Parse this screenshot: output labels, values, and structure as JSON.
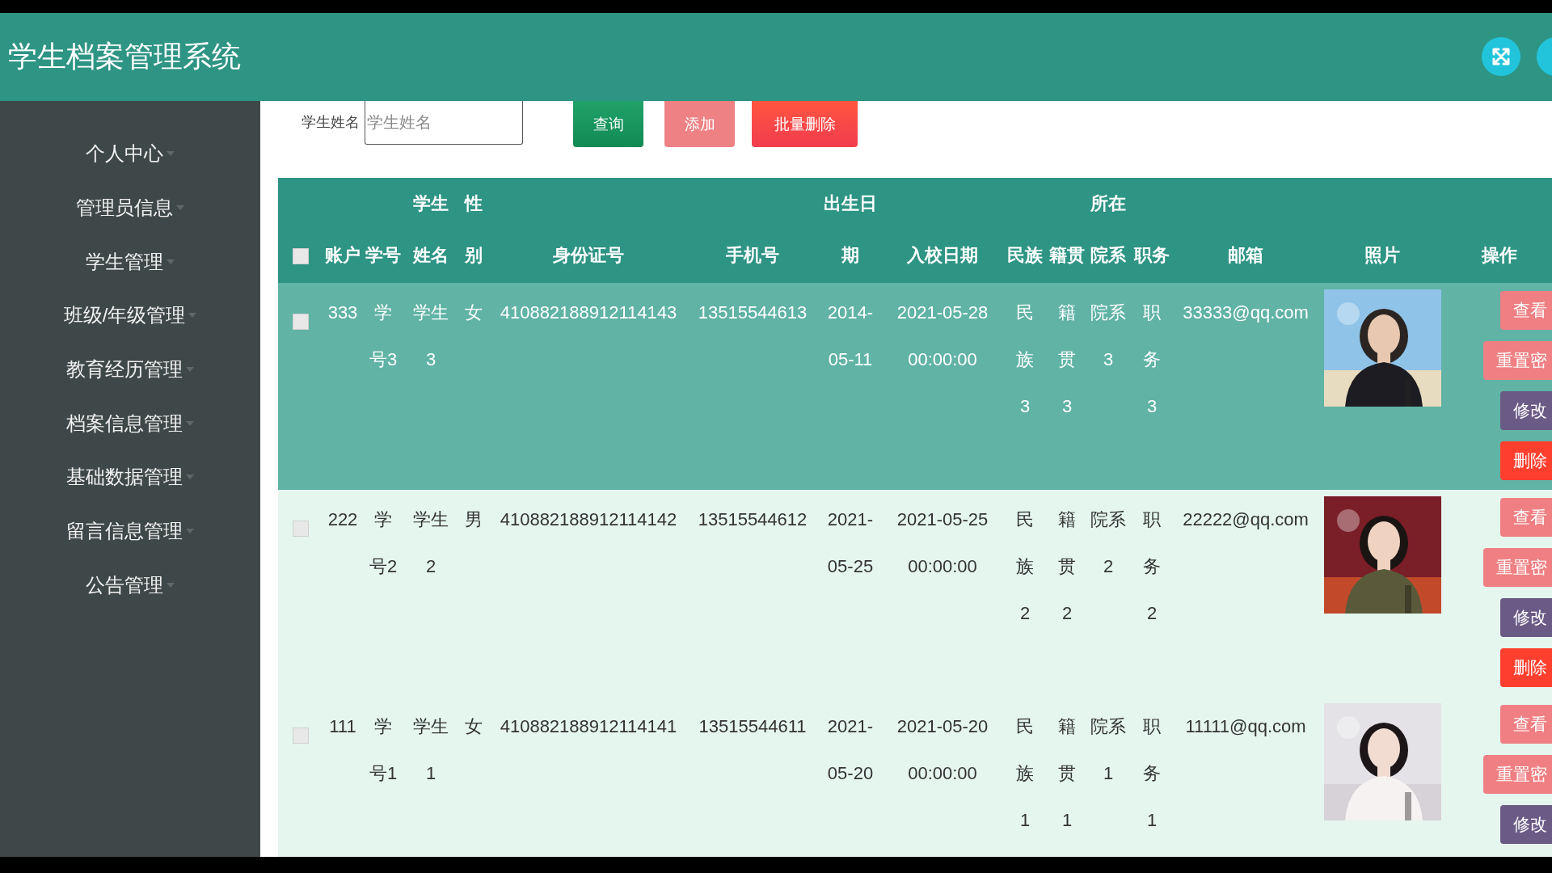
{
  "app": {
    "title": "学生档案管理系统"
  },
  "sidebar": {
    "items": [
      {
        "label": "个人中心"
      },
      {
        "label": "管理员信息"
      },
      {
        "label": "学生管理"
      },
      {
        "label": "班级/年级管理"
      },
      {
        "label": "教育经历管理"
      },
      {
        "label": "档案信息管理"
      },
      {
        "label": "基础数据管理"
      },
      {
        "label": "留言信息管理"
      },
      {
        "label": "公告管理"
      }
    ]
  },
  "search": {
    "label": "学生姓名",
    "placeholder": "学生姓名",
    "buttons": [
      {
        "label": "查询",
        "kind": "search"
      },
      {
        "label": "添加",
        "kind": "add"
      },
      {
        "label": "批量删除",
        "kind": "delete"
      }
    ]
  },
  "table": {
    "select_all": {
      "checked": false
    },
    "columns": [
      "账户",
      "学号",
      "学生姓名",
      "性别",
      "身份证号",
      "手机号",
      "出生日期",
      "入校日期",
      "民族",
      "籍贯",
      "所在院系",
      "职务",
      "邮箱",
      "照片",
      "操作"
    ],
    "rows": [
      {
        "selected": true,
        "checked": false,
        "cells": [
          "333",
          "学号3",
          "学生3",
          "女",
          "410882188912114143",
          "13515544613",
          "2014-05-11",
          "2021-05-28 00:00:00",
          "民族3",
          "籍贯3",
          "院系3",
          "职务3",
          "33333@qq.com"
        ],
        "actions": [
          {
            "label": "查看",
            "kind": "view"
          },
          {
            "label": "重置密",
            "kind": "reset"
          },
          {
            "label": "修改",
            "kind": "edit"
          },
          {
            "label": "删除",
            "kind": "delete"
          }
        ]
      },
      {
        "selected": false,
        "checked": false,
        "cells": [
          "222",
          "学号2",
          "学生2",
          "男",
          "410882188912114142",
          "13515544612",
          "2021-05-25",
          "2021-05-25 00:00:00",
          "民族2",
          "籍贯2",
          "院系2",
          "职务2",
          "22222@qq.com"
        ],
        "actions": [
          {
            "label": "查看",
            "kind": "view"
          },
          {
            "label": "重置密",
            "kind": "reset"
          },
          {
            "label": "修改",
            "kind": "edit"
          },
          {
            "label": "删除",
            "kind": "delete"
          }
        ]
      },
      {
        "selected": false,
        "checked": false,
        "cells": [
          "111",
          "学号1",
          "学生1",
          "女",
          "410882188912114141",
          "13515544611",
          "2021-05-20",
          "2021-05-20 00:00:00",
          "民族1",
          "籍贯1",
          "院系1",
          "职务1",
          "11111@qq.com"
        ],
        "actions": [
          {
            "label": "查看",
            "kind": "view"
          },
          {
            "label": "重置密",
            "kind": "reset"
          },
          {
            "label": "修改",
            "kind": "edit"
          }
        ]
      }
    ]
  }
}
